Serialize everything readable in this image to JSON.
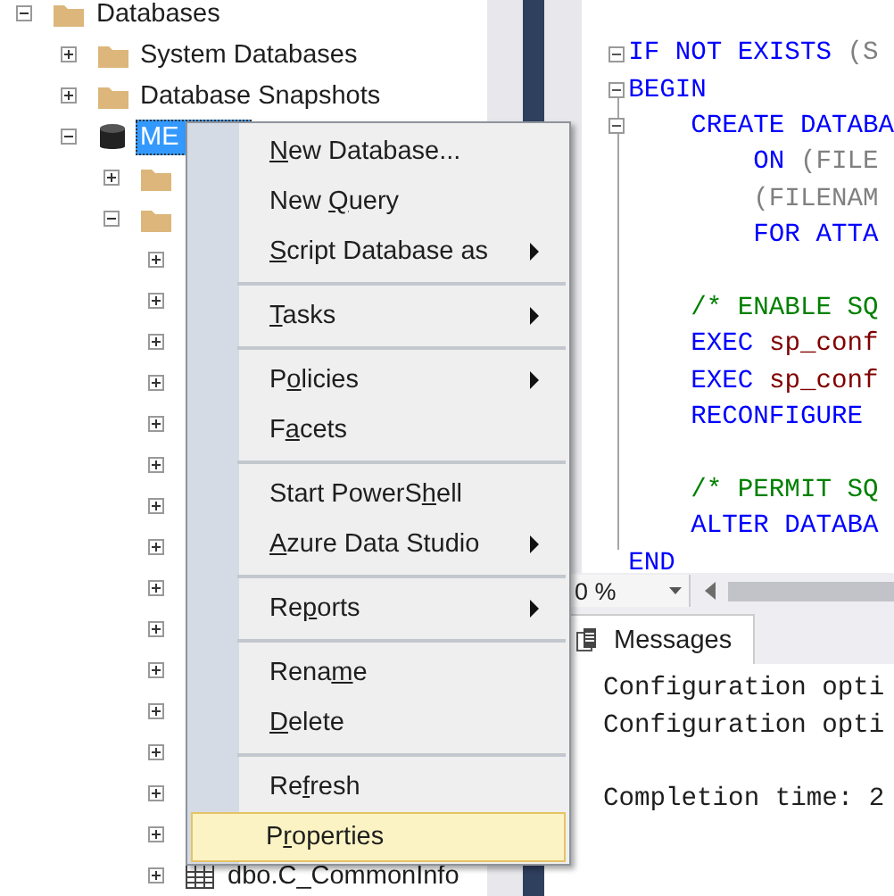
{
  "object_explorer": {
    "tree": [
      {
        "label": "Databases",
        "kind": "folder",
        "expanded": true,
        "selected": false,
        "children": [
          {
            "label": "System Databases",
            "kind": "folder",
            "expanded": false,
            "selected": false
          },
          {
            "label": "Database Snapshots",
            "kind": "folder",
            "expanded": false,
            "selected": false
          },
          {
            "label": "ME",
            "kind": "database",
            "expanded": true,
            "selected": true,
            "children": [
              {
                "kind": "folder",
                "expanded": false,
                "selected": false
              },
              {
                "kind": "folder",
                "expanded": true,
                "selected": false,
                "children": [
                  {
                    "expanded": false,
                    "selected": false
                  },
                  {
                    "expanded": false,
                    "selected": false
                  },
                  {
                    "expanded": false,
                    "selected": false
                  },
                  {
                    "expanded": false,
                    "selected": false
                  },
                  {
                    "expanded": false,
                    "selected": false
                  },
                  {
                    "expanded": false,
                    "selected": false
                  },
                  {
                    "expanded": false,
                    "selected": false
                  },
                  {
                    "expanded": false,
                    "selected": false
                  },
                  {
                    "expanded": false,
                    "selected": false
                  },
                  {
                    "expanded": false,
                    "selected": false
                  },
                  {
                    "expanded": false,
                    "selected": false
                  },
                  {
                    "expanded": false,
                    "selected": false
                  },
                  {
                    "expanded": false,
                    "selected": false
                  },
                  {
                    "expanded": false,
                    "selected": false
                  },
                  {
                    "expanded": false,
                    "selected": false
                  },
                  {
                    "label": "dbo.C_CommonInfo",
                    "kind": "table",
                    "expanded": false,
                    "selected": false
                  }
                ]
              }
            ]
          }
        ]
      }
    ]
  },
  "editor": {
    "lines": [
      {
        "fold": true,
        "segments": [
          {
            "text": "IF NOT EXISTS ",
            "kind": "keyword"
          },
          {
            "text": "(S",
            "kind": "operator"
          }
        ]
      },
      {
        "fold": true,
        "segments": [
          {
            "text": "BEGIN",
            "kind": "keyword"
          }
        ]
      },
      {
        "fold": true,
        "segments": [
          {
            "text": "    CREATE DATABA",
            "kind": "keyword"
          }
        ]
      },
      {
        "fold": false,
        "segments": [
          {
            "text": "        ON ",
            "kind": "keyword"
          },
          {
            "text": "(FILE",
            "kind": "operator"
          }
        ]
      },
      {
        "fold": false,
        "segments": [
          {
            "text": "        (FILENAM",
            "kind": "operator"
          }
        ]
      },
      {
        "fold": false,
        "segments": [
          {
            "text": "        FOR ATTA",
            "kind": "keyword"
          }
        ]
      },
      {
        "fold": false
      },
      {
        "fold": false,
        "segments": [
          {
            "text": "    /* ENABLE SQ",
            "kind": "comment"
          }
        ]
      },
      {
        "fold": false,
        "segments": [
          {
            "text": "    EXEC ",
            "kind": "keyword"
          },
          {
            "text": "sp_conf",
            "kind": "procedure"
          }
        ]
      },
      {
        "fold": false,
        "segments": [
          {
            "text": "    EXEC ",
            "kind": "keyword"
          },
          {
            "text": "sp_conf",
            "kind": "procedure"
          }
        ]
      },
      {
        "fold": false,
        "segments": [
          {
            "text": "    RECONFIGURE",
            "kind": "keyword"
          }
        ]
      },
      {
        "fold": false
      },
      {
        "fold": false,
        "segments": [
          {
            "text": "    /* PERMIT SQ",
            "kind": "comment"
          }
        ]
      },
      {
        "fold": false,
        "segments": [
          {
            "text": "    ALTER DATABA",
            "kind": "keyword"
          }
        ]
      },
      {
        "fold": false,
        "segments": [
          {
            "text": "END",
            "kind": "keyword"
          }
        ]
      }
    ]
  },
  "zoom": {
    "value": "0 %"
  },
  "results": {
    "tabs": [
      {
        "label": "Messages",
        "selected": true
      }
    ],
    "messages": [
      {
        "kind": "text",
        "text": "Configuration opti"
      },
      {
        "kind": "text",
        "text": "Configuration opti"
      },
      {
        "kind": "blank"
      },
      {
        "kind": "text",
        "text": "Completion time: 2"
      }
    ]
  },
  "context_menu": {
    "items": [
      {
        "kind": "item",
        "key": "N",
        "after": "ew Database...",
        "submenu": false,
        "selected": false
      },
      {
        "kind": "item",
        "before": "New ",
        "key": "Q",
        "after": "uery",
        "submenu": false,
        "selected": false
      },
      {
        "kind": "item",
        "key": "S",
        "after": "cript Database as",
        "submenu": true,
        "selected": false
      },
      {
        "kind": "separator"
      },
      {
        "kind": "item",
        "key": "T",
        "after": "asks",
        "submenu": true,
        "selected": false
      },
      {
        "kind": "separator"
      },
      {
        "kind": "item",
        "before": "P",
        "key": "o",
        "after": "licies",
        "submenu": true,
        "selected": false
      },
      {
        "kind": "item",
        "before": "F",
        "key": "a",
        "after": "cets",
        "submenu": false,
        "selected": false
      },
      {
        "kind": "separator"
      },
      {
        "kind": "item",
        "before": "Start PowerS",
        "key": "h",
        "after": "ell",
        "submenu": false,
        "selected": false
      },
      {
        "kind": "item",
        "key": "A",
        "after": "zure Data Studio",
        "submenu": true,
        "selected": false
      },
      {
        "kind": "separator"
      },
      {
        "kind": "item",
        "before": "Re",
        "key": "p",
        "after": "orts",
        "submenu": true,
        "selected": false
      },
      {
        "kind": "separator"
      },
      {
        "kind": "item",
        "before": "Rena",
        "key": "m",
        "after": "e",
        "submenu": false,
        "selected": false
      },
      {
        "kind": "item",
        "key": "D",
        "after": "elete",
        "submenu": false,
        "selected": false
      },
      {
        "kind": "separator"
      },
      {
        "kind": "item",
        "before": "Re",
        "key": "f",
        "after": "resh",
        "submenu": false,
        "selected": false
      },
      {
        "kind": "item",
        "before": "P",
        "key": "r",
        "after": "operties",
        "submenu": false,
        "selected": true
      }
    ]
  }
}
